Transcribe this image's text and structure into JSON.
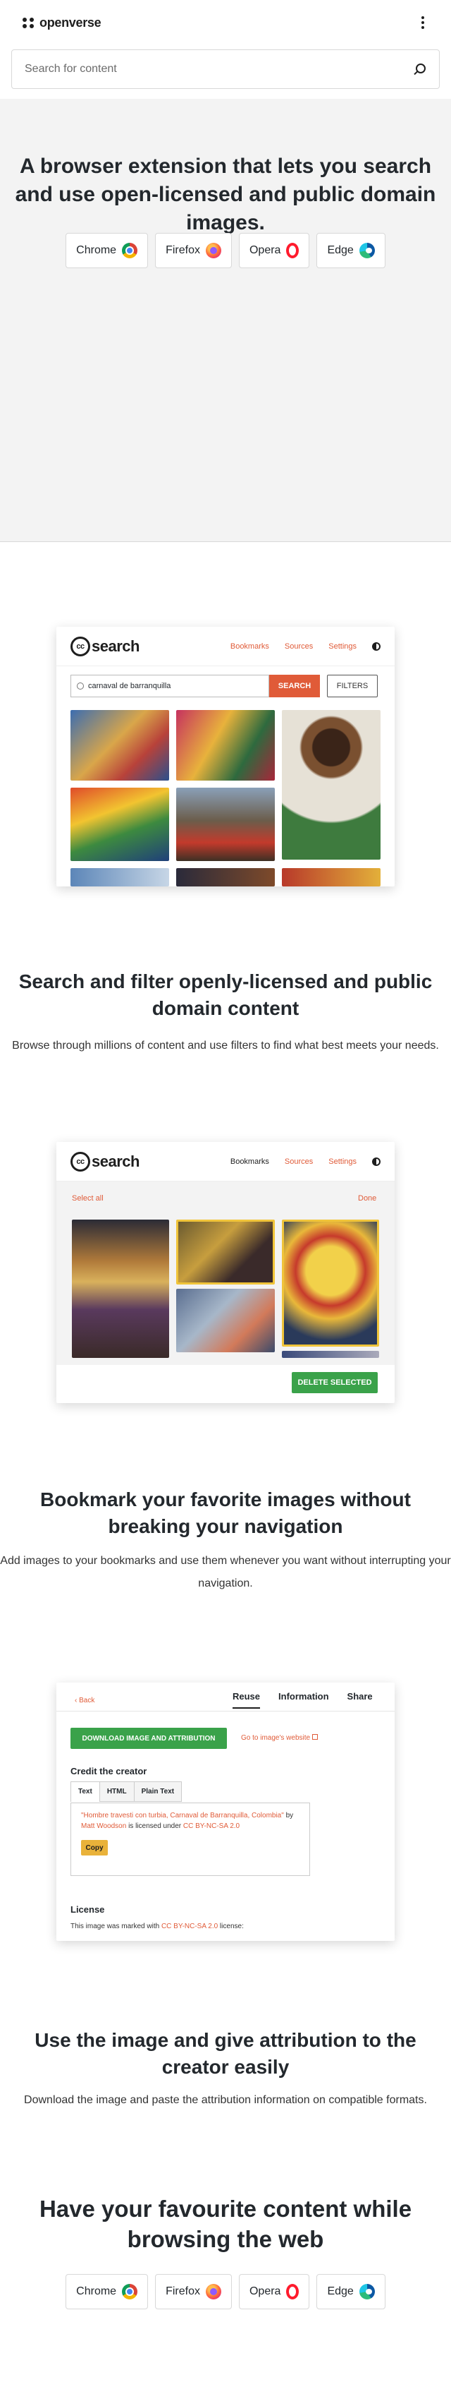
{
  "header": {
    "brand": "openverse",
    "search_placeholder": "Search for content"
  },
  "hero": {
    "title": "A browser extension that lets you search and use open-licensed and public domain images."
  },
  "browsers": [
    {
      "label": "Chrome",
      "icon": "chrome-icon"
    },
    {
      "label": "Firefox",
      "icon": "firefox-icon"
    },
    {
      "label": "Opera",
      "icon": "opera-icon"
    },
    {
      "label": "Edge",
      "icon": "edge-icon"
    }
  ],
  "shot_nav": {
    "brand": "search",
    "cc": "cc",
    "bookmarks": "Bookmarks",
    "sources": "Sources",
    "settings": "Settings"
  },
  "feature1": {
    "query": "carnaval de barranquilla",
    "search_button": "SEARCH",
    "filters_button": "FILTERS",
    "title": "Search and filter openly-licensed and public domain content",
    "description": "Browse through millions of content and use filters to find what best meets your needs."
  },
  "feature2": {
    "select_all": "Select all",
    "done": "Done",
    "delete_button": "DELETE SELECTED",
    "title": "Bookmark your favorite images without breaking your navigation",
    "description": "Add images to your bookmarks and use them whenever you want without interrupting your navigation."
  },
  "feature3": {
    "back": "Back",
    "tabs": [
      "Reuse",
      "Information",
      "Share"
    ],
    "download_button": "DOWNLOAD IMAGE AND ATTRIBUTION",
    "go_to_website": "Go to image's website",
    "credit_heading": "Credit the creator",
    "format_tabs": [
      "Text",
      "HTML",
      "Plain Text"
    ],
    "attribution_title": "\"Hombre travesti con turbia, Carnaval de Barranquilla, Colombia\"",
    "attribution_by": " by ",
    "attribution_author": "Matt Woodson",
    "attribution_licensed": " is licensed under ",
    "attribution_license": "CC BY-NC-SA 2.0",
    "copy_button": "Copy",
    "license_heading": "License",
    "license_text_pre": "This image was marked with ",
    "license_text_link": "CC BY-NC-SA 2.0",
    "license_text_post": " license:",
    "title": "Use the image and give attribution to the creator easily",
    "description": "Download the image and paste the attribution information on compatible formats."
  },
  "final": {
    "title": "Have your favourite content while browsing the web"
  },
  "colors": {
    "accent": "#e05b38",
    "green": "#3aa24a",
    "hero_bg": "#f3f3f3"
  }
}
